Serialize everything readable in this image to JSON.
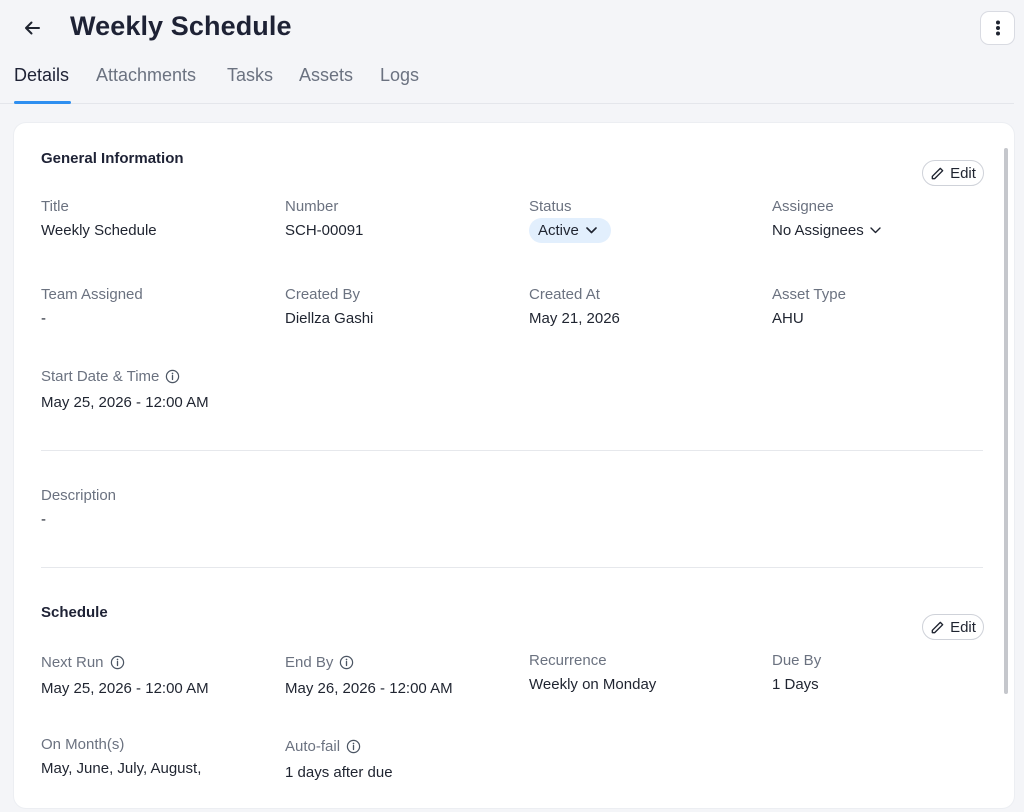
{
  "header": {
    "title": "Weekly Schedule"
  },
  "tabs": [
    {
      "label": "Details"
    },
    {
      "label": "Attachments"
    },
    {
      "label": "Tasks"
    },
    {
      "label": "Assets"
    },
    {
      "label": "Logs"
    }
  ],
  "general": {
    "title": "General Information",
    "edit_label": "Edit",
    "fields": {
      "title": {
        "label": "Title",
        "value": "Weekly Schedule"
      },
      "number": {
        "label": "Number",
        "value": "SCH-00091"
      },
      "status": {
        "label": "Status",
        "value": "Active"
      },
      "assignee": {
        "label": "Assignee",
        "value": "No Assignees"
      },
      "team": {
        "label": "Team Assigned",
        "value": "-"
      },
      "created_by": {
        "label": "Created By",
        "value": "Diellza Gashi"
      },
      "created_at": {
        "label": "Created At",
        "value": "May 21, 2026"
      },
      "asset_type": {
        "label": "Asset Type",
        "value": "AHU"
      },
      "start": {
        "label": "Start Date & Time",
        "value": "May 25, 2026 - 12:00 AM"
      }
    }
  },
  "description": {
    "label": "Description",
    "value": "-"
  },
  "schedule": {
    "title": "Schedule",
    "edit_label": "Edit",
    "fields": {
      "next_run": {
        "label": "Next Run",
        "value": "May 25, 2026 - 12:00 AM"
      },
      "end_by": {
        "label": "End By",
        "value": "May 26, 2026 - 12:00 AM"
      },
      "recurrence": {
        "label": "Recurrence",
        "value": "Weekly on Monday"
      },
      "due_by": {
        "label": "Due By",
        "value": "1 Days"
      },
      "on_months": {
        "label": "On Month(s)",
        "value": "May, June, July, August,"
      },
      "auto_fail": {
        "label": "Auto-fail",
        "value": "1 days after due"
      }
    }
  },
  "colors": {
    "accent": "#2e8ff0",
    "status_bg": "#e2effd"
  }
}
